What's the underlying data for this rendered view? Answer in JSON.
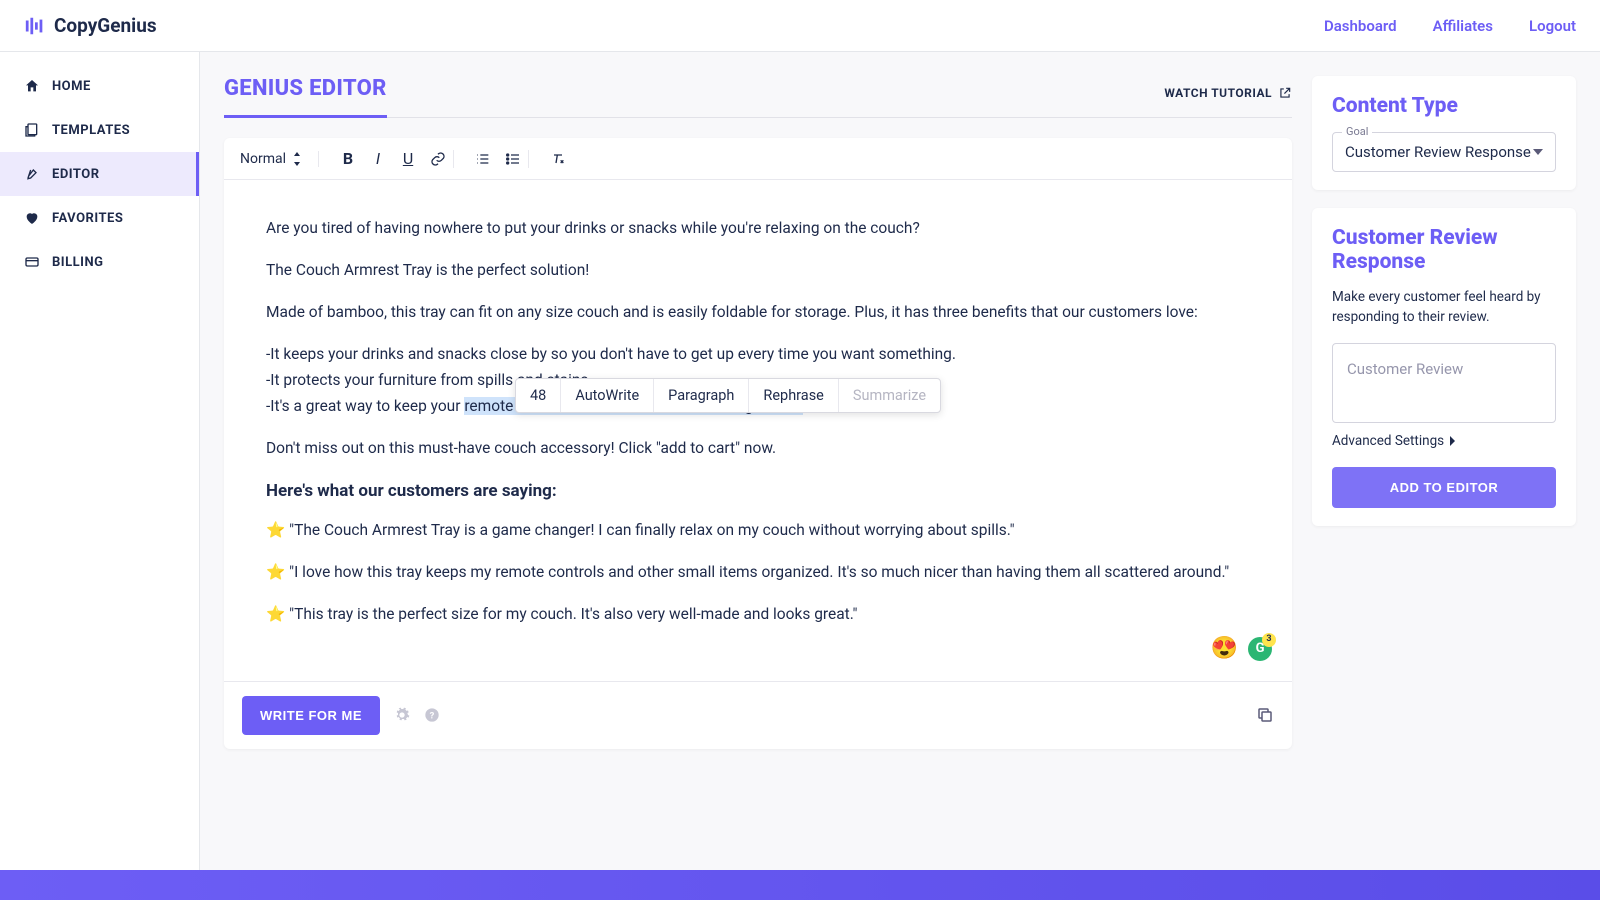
{
  "brand": "CopyGenius",
  "header": {
    "dashboard": "Dashboard",
    "affiliates": "Affiliates",
    "logout": "Logout"
  },
  "sidebar": {
    "home": "HOME",
    "templates": "TEMPLATES",
    "editor": "EDITOR",
    "favorites": "FAVORITES",
    "billing": "BILLING"
  },
  "page": {
    "title": "GENIUS EDITOR",
    "watch": "WATCH TUTORIAL"
  },
  "toolbar": {
    "format": "Normal"
  },
  "float": {
    "count": "48",
    "autowrite": "AutoWrite",
    "paragraph": "Paragraph",
    "rephrase": "Rephrase",
    "summarize": "Summarize"
  },
  "content": {
    "p1": "Are you tired of having nowhere to put your drinks or snacks while you're relaxing on the couch?",
    "p2": "The Couch Armrest Tray is the perfect solution!",
    "p3": "Made of bamboo, this tray can fit on any size couch and is easily foldable for storage. Plus, it has three benefits that our customers love:",
    "b1": "-It keeps your drinks and snacks close by so you don't have to get up every time you want something.",
    "b2": "-It protects your furniture from spills and stains.",
    "b3a": "-It's a great way to keep your ",
    "b3b": "remote controls and other small items organized.",
    "p4": "Don't miss out on this must-have couch accessory! Click \"add to cart\" now.",
    "sub": "Here's what our customers are saying:",
    "r1": "⭐ \"The Couch Armrest Tray is a game changer! I can finally relax on my couch without worrying about spills.\"",
    "r2": "⭐ \"I love how this tray keeps my remote controls and other small items organized. It's so much nicer than having them all scattered around.\"",
    "r3": "⭐ \"This tray is the perfect size for my couch. It's also very well-made and looks great.\""
  },
  "gram_badge": "3",
  "buttons": {
    "write": "WRITE FOR ME",
    "add": "ADD TO EDITOR"
  },
  "right": {
    "content_type": "Content Type",
    "goal_label": "Goal",
    "goal_value": "Customer Review Response",
    "section_title": "Customer Review Response",
    "section_desc": "Make every customer feel heard by responding to their review.",
    "textarea_ph": "Customer Review",
    "adv": "Advanced Settings"
  }
}
